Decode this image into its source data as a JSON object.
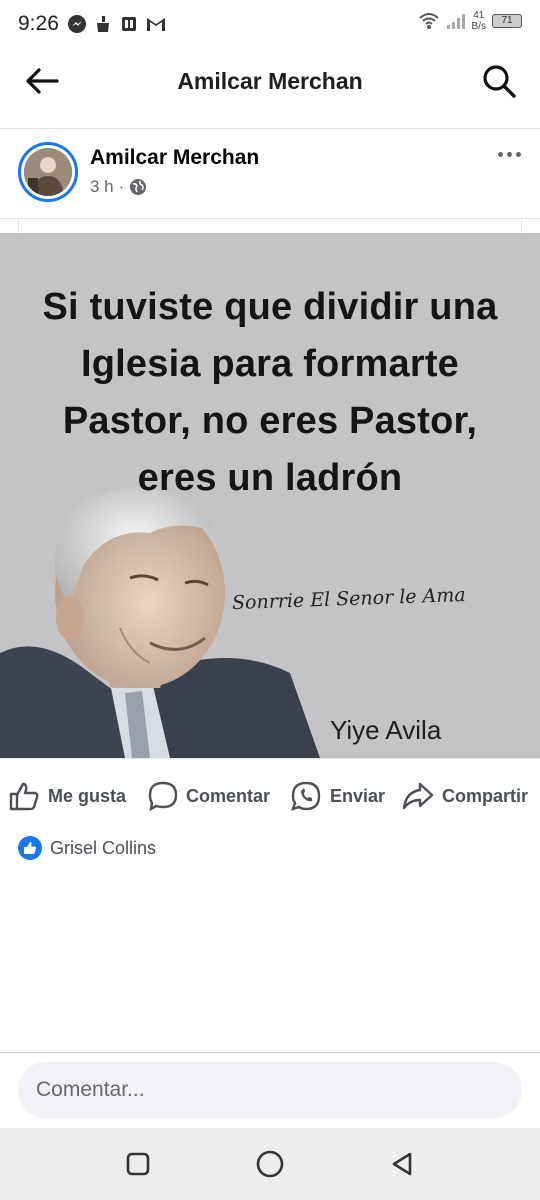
{
  "status_bar": {
    "time": "9:26",
    "net_speed_value": "41",
    "net_speed_unit": "B/s",
    "battery": "71"
  },
  "app_bar": {
    "title": "Amilcar Merchan"
  },
  "post": {
    "author": "Amilcar Merchan",
    "time_ago": "3 h",
    "separator": "·",
    "image": {
      "quote": "Si tuviste que dividir una Iglesia para formarte Pastor, no eres Pastor, eres un ladrón",
      "signature": "Sonrrie El Senor le Ama",
      "caption": "Yiye Avila"
    }
  },
  "actions": {
    "like": "Me gusta",
    "comment": "Comentar",
    "send": "Enviar",
    "share": "Compartir"
  },
  "reactions": {
    "names": "Grisel Collins"
  },
  "comment_input": {
    "placeholder": "Comentar..."
  },
  "colors": {
    "accent": "#1877f2",
    "text_secondary": "#65676b",
    "image_bg": "#c4c4c6"
  }
}
